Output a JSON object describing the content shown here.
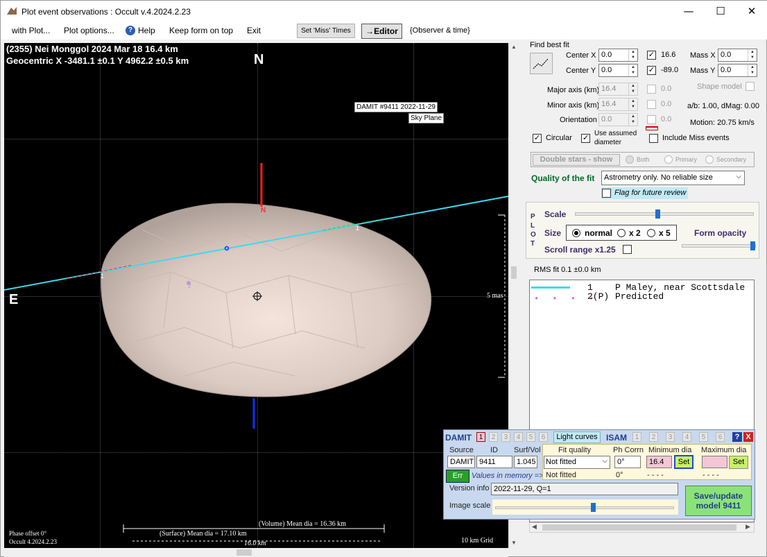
{
  "window": {
    "title": "Plot event observations : Occult v.4.2024.2.23",
    "minimize": "—",
    "maximize": "☐",
    "close": "✕"
  },
  "menu": {
    "with_plot": "with Plot...",
    "plot_options": "Plot options...",
    "help": "Help",
    "keep_form": "Keep form on top",
    "exit": "Exit",
    "set_miss": "Set 'Miss' Times",
    "editor": "→Editor",
    "observer_time": "{Observer & time}"
  },
  "plot": {
    "header1": "(2355) Nei Monggol  2024 Mar 18   16.4 km",
    "header2": "Geocentric  X  -3481.1 ±0.1  Y 4962.2 ±0.5 km",
    "north": "N",
    "east": "E",
    "damit_label": "DAMIT #9411 2022-11-29",
    "sky_plane": "Sky Plane",
    "mas": "5 mas",
    "phase_offset": "Phase offset 0°",
    "occult_version": "Occult 4.2024.2.23",
    "grid": "10 km Grid",
    "volume_dia": "(Volume) Mean dia = 16.36 km",
    "surface_dia": "(Surface) Mean dia = 17.10 km",
    "scale_km": "16.0 km",
    "n_mark": "N",
    "chord1": "1",
    "chord2": "2"
  },
  "fit": {
    "find_best_fit": "Find best fit",
    "center_x_label": "Center X",
    "center_x": "0.0",
    "center_y_label": "Center Y",
    "center_y": "0.0",
    "val_16_6": "16.6",
    "val_89": "-89.0",
    "mass_x_label": "Mass X",
    "mass_x": "0.0",
    "mass_y_label": "Mass Y",
    "mass_y": "0.0",
    "major_label": "Major axis (km)",
    "major": "16.4",
    "minor_label": "Minor axis (km)",
    "minor": "16.4",
    "orient_label": "Orientation",
    "orient": "0.0",
    "dis1": "0.0",
    "dis2": "0.0",
    "dis3": "0.0",
    "shape_model": "Shape model",
    "ab_dmag": "a/b: 1.00, dMag: 0.00",
    "motion": "Motion: 20.75 km/s",
    "circular": "Circular",
    "use_assumed": "Use assumed",
    "diameter": "diameter",
    "include_miss": "Include Miss events",
    "double_stars": "Double stars - show",
    "both": "Both",
    "primary": "Primary",
    "secondary": "Secondary",
    "quality_label": "Quality of the fit",
    "quality_value": "Astrometry only. No reliable size",
    "flag_review": "Flag for future review"
  },
  "plotpanel": {
    "plot_vert": "PLOT",
    "scale": "Scale",
    "size": "Size",
    "normal": "normal",
    "x2": "x 2",
    "x5": "x 5",
    "form_opacity": "Form opacity",
    "scroll_range": "Scroll range x1.25",
    "scale_fraction": 0.46,
    "opacity_fraction": 0.98
  },
  "rms": "RMS fit 0.1 ±0.0 km",
  "observers": [
    {
      "num": "1",
      "name": "P Maley, near Scottsdale",
      "color": "#40d8f0"
    },
    {
      "num": "2(P)",
      "name": "Predicted",
      "color": "#e060b0"
    }
  ],
  "damit": {
    "title": "DAMIT",
    "nums": [
      "1",
      "2",
      "3",
      "4",
      "5",
      "6"
    ],
    "light_curves": "Light curves",
    "isam": "ISAM",
    "isam_nums": [
      "1",
      "2",
      "3",
      "4",
      "5",
      "6"
    ],
    "help": "?",
    "close": "X",
    "source_label": "Source",
    "id_label": "ID",
    "surf_label": "Surf/Vol",
    "source": "DAMIT",
    "id": "9411",
    "surf": "1.045",
    "fit_quality_label": "Fit quality",
    "fit_quality": "Not fitted",
    "fit_quality2": "Not fitted",
    "ph_corr_label": "Ph Corrn",
    "ph_corr": "0°",
    "ph_corr2": "0°",
    "min_dia_label": "Minimum dia",
    "min_dia": "16.4",
    "min_dash": "- - - -",
    "max_dia_label": "Maximum dia",
    "max_dash": "- - - -",
    "set": "Set",
    "err": "Err",
    "values_memory": "Values in memory =>",
    "version_label": "Version info",
    "version": "2022-11-29, Q=1",
    "image_scale": "Image scale",
    "save": "Save/update",
    "model": "model 9411",
    "image_scale_fraction": 0.55
  }
}
